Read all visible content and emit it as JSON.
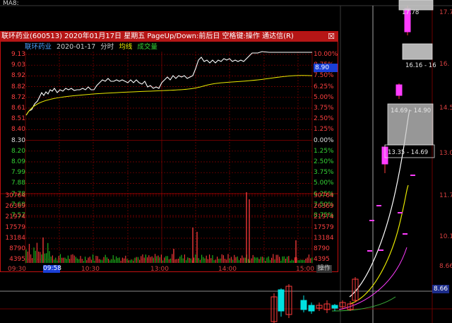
{
  "colors": {
    "up": "#ff3b3b",
    "down": "#00e0e0",
    "price_line": "#ffffff",
    "avg_line": "#e8e800",
    "grid": "#8b0000",
    "magenta": "#ff3cff",
    "title_bar": "#b51616"
  },
  "top_bar": {
    "ma_label": "MA8:"
  },
  "background_chart": {
    "right_axis": [
      "17.7",
      "16.",
      "14.5",
      "13.0",
      "11.7",
      "10.1",
      "8.66"
    ],
    "current_price_marker": "8.66",
    "boxes": [
      {
        "label": "17.78"
      },
      {
        "label": "16.16 - 16"
      },
      {
        "label": "14.69 - 14.90"
      },
      {
        "label": "13.35 - 14.69"
      }
    ]
  },
  "popup": {
    "title": "联环药业(600513) 2020年01月17日 星期五 PageUp/Down:前后日 空格键:操作 通达信(R)",
    "close_icon": "☒",
    "subheader": {
      "stock_name": "联环药业",
      "date": "2020-01-17",
      "mode": "分时",
      "avg_label": "均线",
      "volume_label": "成交量"
    },
    "price_axis_left": [
      "9.13",
      "9.03",
      "8.92",
      "8.82",
      "8.72",
      "8.61",
      "8.51",
      "8.40",
      "8.30",
      "8.20",
      "8.09",
      "7.99",
      "7.88",
      "7.78",
      "7.68",
      "7.57"
    ],
    "pct_axis_right": [
      "10.00%",
      "8.75%",
      "7.50%",
      "6.25%",
      "5.00%",
      "3.75%",
      "2.50%",
      "1.25%",
      "0.00%",
      "1.25%",
      "2.50%",
      "3.75%",
      "5.00%",
      "6.25%",
      "7.50%",
      "8.75%"
    ],
    "current_price_tag": "8.90",
    "volume_axis_left": [
      "30764",
      "26369",
      "21974",
      "17579",
      "13184",
      "8790",
      "4395"
    ],
    "volume_axis_right": [
      "30764",
      "26369",
      "21974",
      "17579",
      "13184",
      "8790",
      "4395"
    ],
    "time_labels": [
      "09:30",
      "10:30",
      "13:00",
      "14:00",
      "15:00"
    ],
    "time_cursor": "09:58",
    "op_button": "操作"
  }
}
